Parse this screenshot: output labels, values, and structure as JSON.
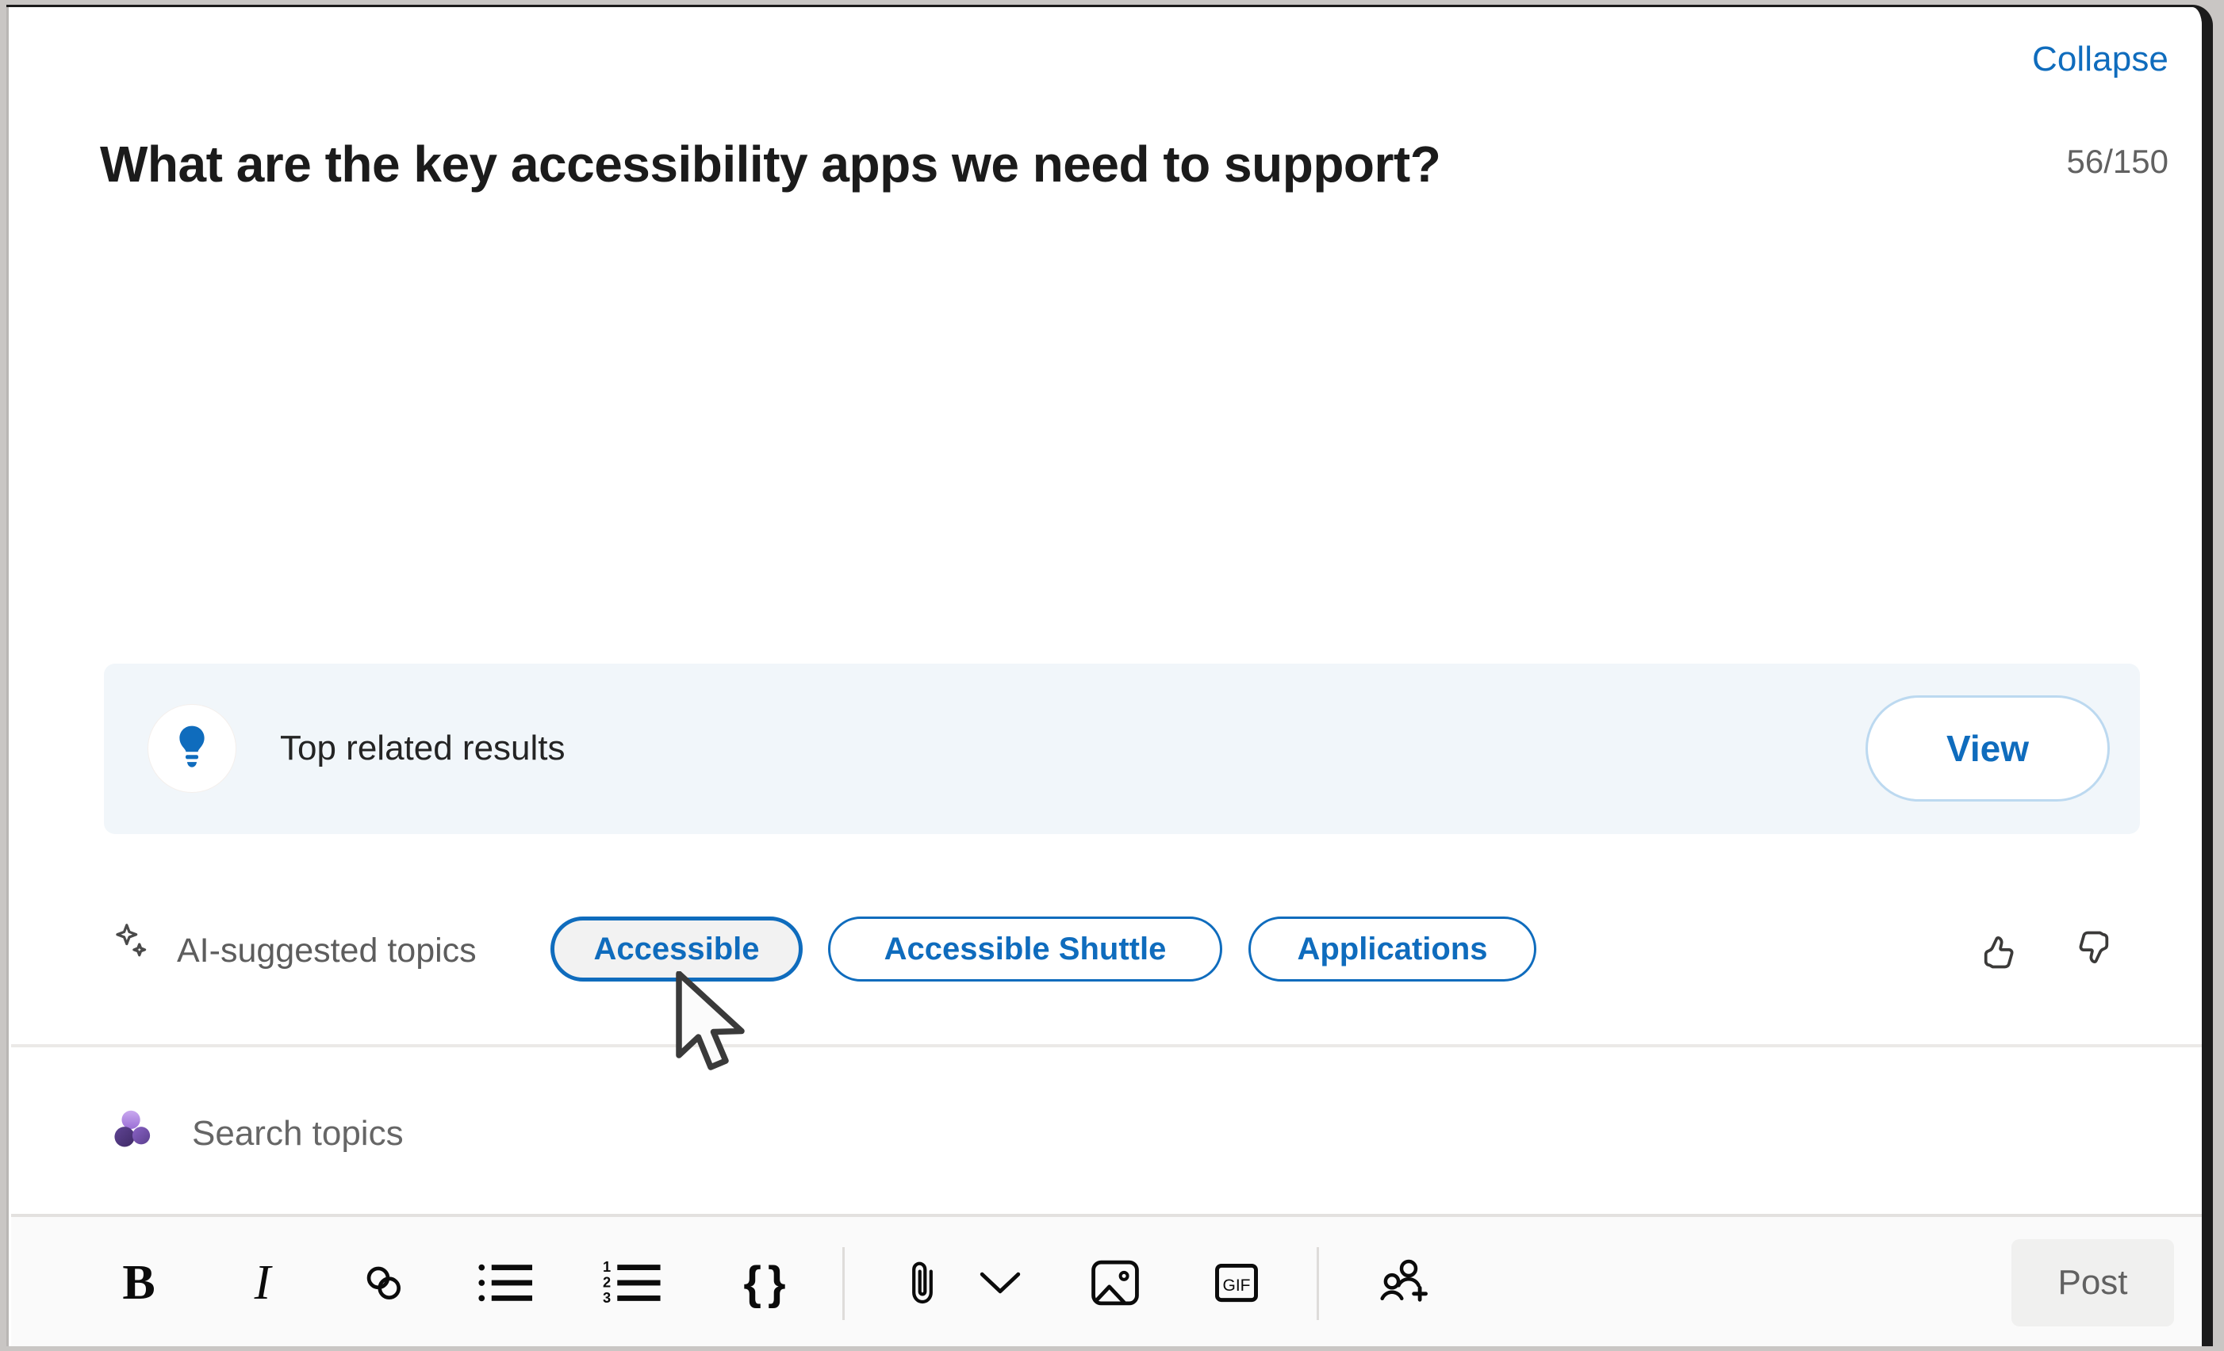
{
  "header": {
    "collapse_label": "Collapse",
    "char_count": "56/150",
    "title": "What are the key accessibility apps we need to support?"
  },
  "related": {
    "icon": "lightbulb-icon",
    "label": "Top related results",
    "view_label": "View"
  },
  "ai_topics": {
    "icon": "sparkle-icon",
    "label": "AI-suggested topics",
    "chips": [
      {
        "label": "Accessible",
        "state": "hovered"
      },
      {
        "label": "Accessible Shuttle",
        "state": "default"
      },
      {
        "label": "Applications",
        "state": "default"
      }
    ],
    "feedback": {
      "thumbs_up": "thumbs-up-icon",
      "thumbs_down": "thumbs-down-icon"
    }
  },
  "topic_search": {
    "icon": "viva-topics-icon",
    "placeholder": "Search topics",
    "value": ""
  },
  "toolbar": {
    "items": [
      {
        "name": "bold-icon",
        "label": "B"
      },
      {
        "name": "italic-icon",
        "label": "I"
      },
      {
        "name": "link-icon",
        "label": ""
      },
      {
        "name": "bulleted-list-icon",
        "label": ""
      },
      {
        "name": "numbered-list-icon",
        "label": ""
      },
      {
        "name": "code-icon",
        "label": "{ }"
      },
      {
        "name": "attach-icon",
        "label": ""
      },
      {
        "name": "chevron-down-icon",
        "label": ""
      },
      {
        "name": "image-icon",
        "label": ""
      },
      {
        "name": "gif-icon",
        "label": "GIF"
      },
      {
        "name": "mention-people-icon",
        "label": ""
      }
    ],
    "numbered_list_digits": [
      "1",
      "2",
      "3"
    ],
    "gif_label": "GIF",
    "post_label": "Post"
  },
  "colors": {
    "accent_blue": "#0f6cbd",
    "banner_bg": "#f1f6fa",
    "toolbar_bg": "#fafafa",
    "muted_text": "#616161",
    "topics_purple": "#5b3f8e"
  }
}
